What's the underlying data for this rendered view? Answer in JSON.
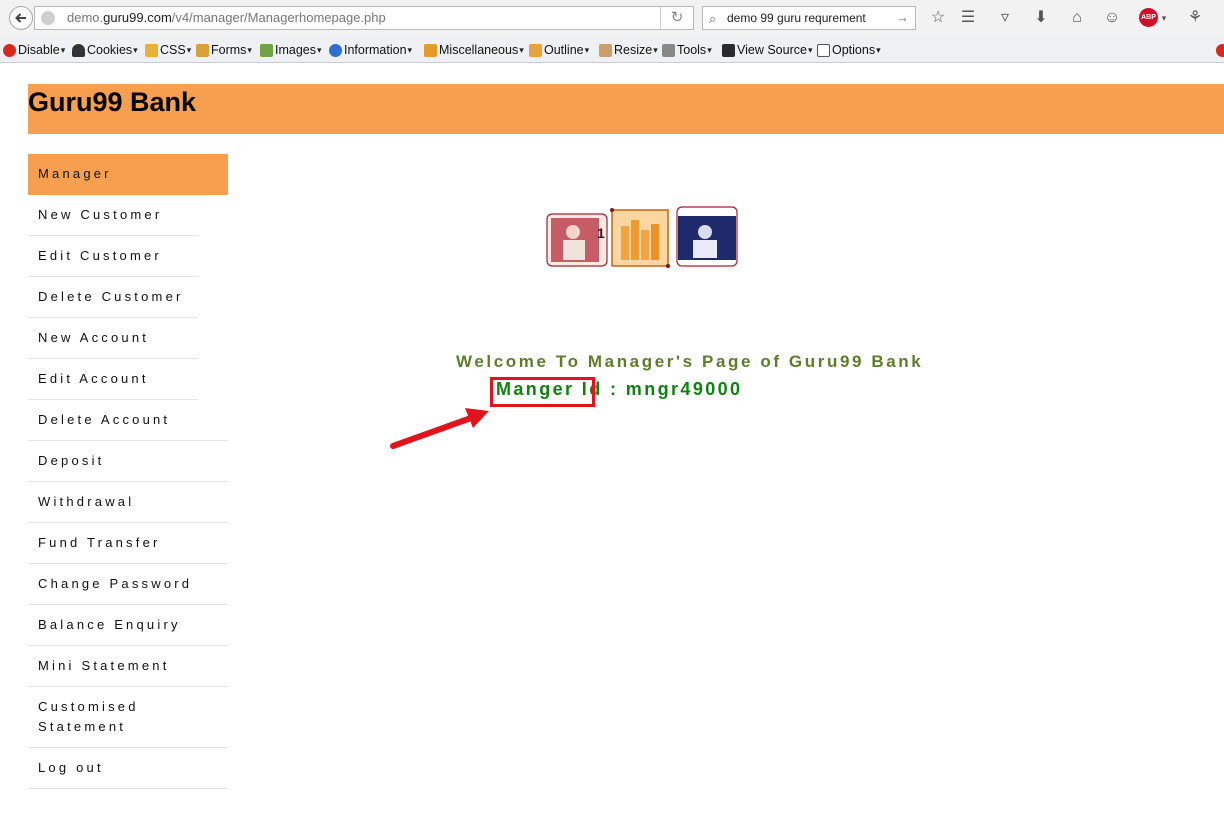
{
  "browser": {
    "url_host_prefix": "demo.",
    "url_host": "guru99.com",
    "url_path": "/v4/manager/Managerhomepage.php",
    "search_query": "demo 99 guru requrement",
    "abp_label": "ABP"
  },
  "devbar": {
    "items": [
      "Disable",
      "Cookies",
      "CSS",
      "Forms",
      "Images",
      "Information",
      "Miscellaneous",
      "Outline",
      "Resize",
      "Tools",
      "View Source",
      "Options"
    ]
  },
  "page": {
    "bank_title": "Guru99 Bank",
    "welcome": "Welcome To Manager's Page of Guru99 Bank",
    "manager_id": "Manger Id : mngr49000"
  },
  "sidebar": {
    "items": [
      {
        "label": "Manager"
      },
      {
        "label": "New Customer"
      },
      {
        "label": "Edit Customer"
      },
      {
        "label": "Delete Customer"
      },
      {
        "label": "New Account"
      },
      {
        "label": "Edit Account"
      },
      {
        "label": "Delete Account"
      },
      {
        "label": "Deposit"
      },
      {
        "label": "Withdrawal"
      },
      {
        "label": "Fund Transfer"
      },
      {
        "label": "Change Password"
      },
      {
        "label": "Balance Enquiry"
      },
      {
        "label": "Mini Statement"
      },
      {
        "label": "Customised Statement"
      },
      {
        "label": "Log out"
      }
    ]
  },
  "colors": {
    "header_orange": "#f89e4f",
    "welcome_green": "#5e7d2b",
    "manager_id_green": "#108210",
    "annotation_red": "#e0141c"
  }
}
